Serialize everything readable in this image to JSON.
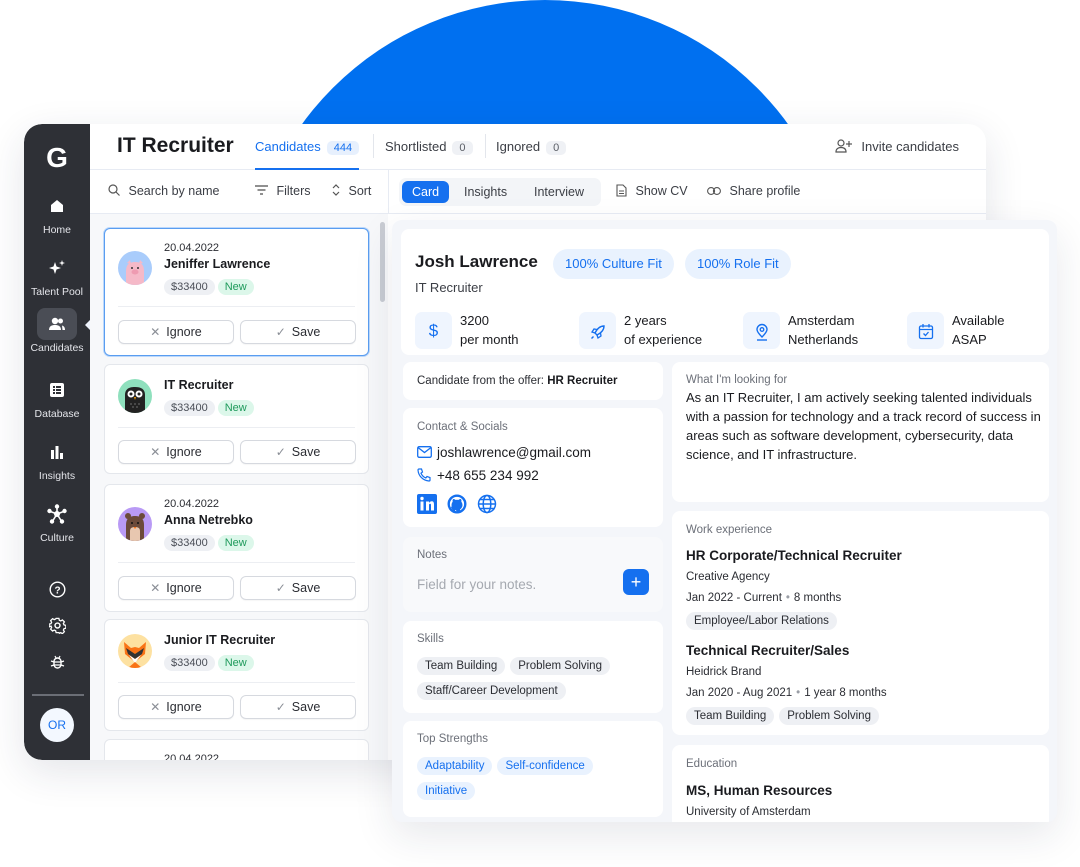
{
  "colors": {
    "accent": "#1570ef",
    "sidebar_bg": "#2e3036",
    "hero_circle": "#0070f0",
    "new_badge": "#1e9a5b"
  },
  "sidebar": {
    "logo": "G",
    "items": [
      {
        "label": "Home",
        "icon": "home-icon",
        "glyph": "⌂"
      },
      {
        "label": "Talent Pool",
        "icon": "sparkles-icon",
        "glyph": "✦"
      },
      {
        "label": "Candidates",
        "icon": "users-icon",
        "glyph": "👥",
        "active": true
      },
      {
        "label": "Database",
        "icon": "list-icon",
        "glyph": "☰"
      },
      {
        "label": "Insights",
        "icon": "bar-chart-icon",
        "glyph": "▮"
      },
      {
        "label": "Culture",
        "icon": "network-icon",
        "glyph": "✱"
      }
    ],
    "utilities": [
      {
        "icon": "help-icon",
        "glyph": "?"
      },
      {
        "icon": "gear-icon",
        "glyph": "⚙"
      },
      {
        "icon": "bug-icon",
        "glyph": "🐞"
      }
    ],
    "user_initials": "OR"
  },
  "header": {
    "title": "IT Recruiter",
    "tabs": [
      {
        "label": "Candidates",
        "count": "444",
        "active": true
      },
      {
        "label": "Shortlisted",
        "count": "0"
      },
      {
        "label": "Ignored",
        "count": "0"
      }
    ],
    "invite_label": "Invite candidates"
  },
  "list_toolbar": {
    "search_placeholder": "Search by name",
    "filters_label": "Filters",
    "sort_label": "Sort"
  },
  "candidates": [
    {
      "date": "20.04.2022",
      "name": "Jeniffer Lawrence",
      "salary": "$33400",
      "status": "New",
      "avatar": "pig",
      "selected": true
    },
    {
      "date": "",
      "name": "IT Recruiter",
      "salary": "$33400",
      "status": "New",
      "avatar": "owl"
    },
    {
      "date": "20.04.2022",
      "name": "Anna Netrebko",
      "salary": "$33400",
      "status": "New",
      "avatar": "bear"
    },
    {
      "date": "",
      "name": "Junior IT Recruiter",
      "salary": "$33400",
      "status": "New",
      "avatar": "fox"
    },
    {
      "date": "20.04.2022",
      "name": "",
      "salary": "",
      "status": "",
      "avatar": ""
    }
  ],
  "card_actions": {
    "ignore": "Ignore",
    "save": "Save"
  },
  "detail_toolbar": {
    "views": [
      {
        "label": "Card",
        "active": true
      },
      {
        "label": "Insights"
      },
      {
        "label": "Interview"
      }
    ],
    "show_cv": "Show CV",
    "share_profile": "Share profile"
  },
  "profile": {
    "name": "Josh Lawrence",
    "role": "IT Recruiter",
    "fits": [
      "100% Culture Fit",
      "100% Role Fit"
    ],
    "stats": [
      {
        "icon": "dollar-icon",
        "glyph": "$",
        "line1": "3200",
        "line2": "per month"
      },
      {
        "icon": "rocket-icon",
        "glyph": "🚀",
        "line1": "2 years",
        "line2": "of experience"
      },
      {
        "icon": "location-icon",
        "glyph": "⌖",
        "line1": "Amsterdam",
        "line2": "Netherlands"
      },
      {
        "icon": "calendar-icon",
        "glyph": "▦",
        "line1": "Available",
        "line2": "ASAP"
      }
    ],
    "offer_prefix": "Candidate from the offer:",
    "offer_name": "HR Recruiter",
    "contact": {
      "title": "Contact & Socials",
      "email": "joshlawrence@gmail.com",
      "phone": "+48 655 234 992",
      "socials": [
        "linkedin-icon",
        "github-icon",
        "globe-icon"
      ]
    },
    "notes": {
      "title": "Notes",
      "placeholder": "Field for your notes."
    },
    "skills": {
      "title": "Skills",
      "items": [
        "Team Building",
        "Problem Solving",
        "Staff/Career Development"
      ]
    },
    "strengths": {
      "title": "Top Strengths",
      "items": [
        "Adaptability",
        "Self-confidence",
        "Initiative"
      ]
    },
    "looking_for": {
      "title": "What I'm looking for",
      "text": "As an IT Recruiter, I am actively seeking talented individuals with a passion for technology and a track record of success in areas such as software development, cybersecurity, data science, and IT infrastructure."
    },
    "work": {
      "title": "Work experience",
      "jobs": [
        {
          "title": "HR Corporate/Technical Recruiter",
          "company": "Creative Agency",
          "period": "Jan 2022 - Current",
          "duration": "8 months",
          "tags": [
            "Employee/Labor Relations"
          ]
        },
        {
          "title": "Technical Recruiter/Sales",
          "company": "Heidrick Brand",
          "period": "Jan 2020 - Aug 2021",
          "duration": "1 year 8 months",
          "tags": [
            "Team Building",
            "Problem Solving"
          ]
        }
      ]
    },
    "education": {
      "title": "Education",
      "degree": "MS, Human Resources",
      "school": "University of Amsterdam"
    }
  }
}
